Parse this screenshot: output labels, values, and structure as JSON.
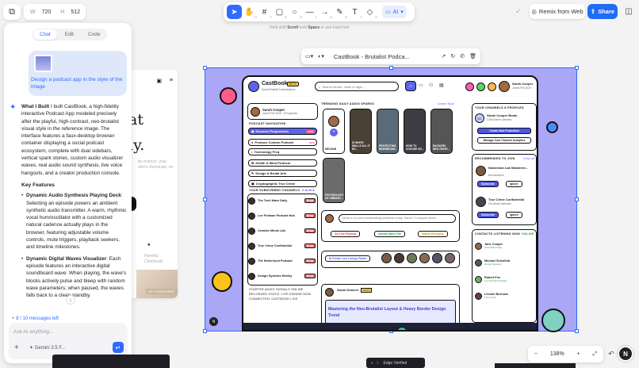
{
  "top_left": {
    "width_label": "W",
    "width_value": "720",
    "height_label": "H",
    "height_value": "512"
  },
  "toolbar": {
    "tools": [
      {
        "icon": "cursor-icon",
        "key": "V"
      },
      {
        "icon": "hand-icon",
        "key": "H"
      },
      {
        "icon": "frame-icon",
        "key": "F"
      },
      {
        "icon": "rectangle-icon",
        "key": "R"
      },
      {
        "icon": "ellipse-icon",
        "key": "O"
      },
      {
        "icon": "line-icon",
        "key": "L"
      },
      {
        "icon": "arrow-icon",
        "key": "A"
      },
      {
        "icon": "pen-icon",
        "key": "P"
      },
      {
        "icon": "text-icon",
        "key": "T"
      },
      {
        "icon": "eraser-icon",
        "key": "E"
      }
    ],
    "ai_label": "AI"
  },
  "hint": {
    "prefix": "Hold shift",
    "scroll": "Scroll",
    "middle": "hold",
    "space": "Space",
    "suffix": "or use hand tool"
  },
  "header_right": {
    "remix_label": "Remix from Web",
    "share_label": "Share"
  },
  "panel": {
    "tabs": [
      "Chat",
      "Edit",
      "Code"
    ],
    "user_message": "Design a podcast app in the style of the image",
    "ai_intro_title": "What I Built",
    "ai_intro": "I built CastBook, a high-fidelity interactive Podcast App modeled precisely after the playful, high-contrast, neo-brutalist visual style in the reference image. The interface features a faux-desktop browser container displaying a social podcast ecosystem, complete with dual sidebars, vertical spark stories, custom audio visualizer waves, real audio sound synthesis, live voice hangouts, and a creator production console.",
    "features_title": "Key Features",
    "feature1_title": "Dynamic Audio Synthesis Playing Deck",
    "feature1_body": "Selecting an episode powers an ambient synthetic audio transmitter. A warm, rhythmic vocal hum/oscillator with a customized natural cadence actually plays in the browser, featuring adjustable volume controls, mute triggers, playback seekers, and timeline milestones.",
    "feature2_title": "Dynamic Digital Waves Visualizer",
    "feature2_body": "Each episode features an interactive digital soundboard wave. When playing, the wave's blocks actively pulse and bleep with random wave parameters; when paused, the waves falls back to a clean standby.",
    "messages_left": "8 / 10 messages left",
    "input_placeholder": "Ask AI anything...",
    "model": "Gemini 3.5 F..."
  },
  "back_preview": {
    "line1": "at",
    "line2": "ly.",
    "small": "by science. your skin's chemicals, no",
    "tag": "KEY INGREDIENT",
    "mini": "Harmful Chemicals"
  },
  "frame_toolbar": {
    "title": "CastBook - Brutalist Podca..."
  },
  "app": {
    "brand": "CastBook",
    "brand_badge": "BETA",
    "brand_sub": "Social Brutalist Transmissions",
    "search_placeholder": "Search shows, hosts or tags...",
    "user_name": "Sarah Cooper",
    "user_sub": "Joined Feb 2025",
    "profile_name": "Sarah Cooper",
    "profile_sub": "Joined Feb 2025 · 24 Episodes",
    "nav_title": "PODCAST NAVIGATION",
    "nav": [
      "Discover Frequencies",
      "Produce Custom Podcast",
      "Technology Freq",
      "Health & Mind Protocol",
      "Design & Brutal Arts",
      "Cryptographic True Crime"
    ],
    "nav_badges": [
      "LIVE",
      "NEW"
    ],
    "subs_title": "YOUR SUBSCRIBED CHANNELS",
    "subs_count": "6 Active",
    "subs": [
      {
        "name": "The Tech Wave Daily",
        "sub": "Drop"
      },
      {
        "name": "Lex Fridman Podcast Hub",
        "sub": "Drop"
      },
      {
        "name": "Creative Minds Lab",
        "sub": "Drop"
      },
      {
        "name": "True Crime Confidential",
        "sub": "Drop"
      },
      {
        "name": "The Neberhood Podcast",
        "sub": "Drop"
      },
      {
        "name": "Design Systems Weekly",
        "sub": "Drop"
      }
    ],
    "sparks_title": "TRENDING DAILY AUDIO SPARKS",
    "sparks_more": "Listen Now",
    "sparks": [
      "SECOND",
      "IS WHITE WALLS ALL IT BY...",
      "PROTECTING NEWSROOM...",
      "HOW TO CHOOSE SO...",
      "BACKERS INFILTRATE...",
      "PSYCHOLOGY OF VIBRANT..."
    ],
    "compose_placeholder": "What is on your broadcasting schedule today, Sarah? Compose show...",
    "compose_actions": [
      "Go Live Podcast",
      "Upload Wave File",
      "Status Energetic"
    ],
    "rooms_label": "Create Live Lounge Room",
    "post_author": "Sarah Drasner",
    "post_badge": "HOST",
    "post_title": "Mastering the Neo-Brutalist Layout & Heavy Border Design Trend",
    "channels_title": "YOUR CHANNELS & PROFILES",
    "channel_name": "Sarah Cooper Beats",
    "channel_sub": "2,005 Active Listeners",
    "channel_btn1": "Create New Promotion",
    "channel_btn2": "Manage Your Channel Analytics",
    "recommended_title": "RECOMMENDED TO JOIN",
    "recommended_more": "View all",
    "recommended": [
      {
        "name": "Noberman Lab Mastermi...",
        "sub": "Neuroscience"
      },
      {
        "name": "True Crime Confidential",
        "sub": "18 Unread Episodes"
      }
    ],
    "subscribe": "Subscribe",
    "ignore": "Ignore",
    "contacts_title": "CONTACTS LISTENING NOW",
    "contacts_status": "ONLINE",
    "contacts": [
      {
        "name": "Jane Cooper",
        "sub": "Tech Wave Daily"
      },
      {
        "name": "Michael Schofield",
        "sub": "Design Systems"
      },
      {
        "name": "Robert Fox",
        "sub": "Lex Fridman Podcast"
      },
      {
        "name": "Lincoln Burrows",
        "sub": "True Crime"
      }
    ],
    "footer_lines": [
      "STARTER AUDIO SIGNALS ONLINE",
      "RECORDED STATIC: LIFE ENGINE NOW",
      "CONNECTED: CASTBOOK LIVE"
    ]
  },
  "zoom": {
    "level": "138%"
  },
  "bottom": {
    "edge_label": "Edge Verified",
    "corner_letter": "N"
  }
}
